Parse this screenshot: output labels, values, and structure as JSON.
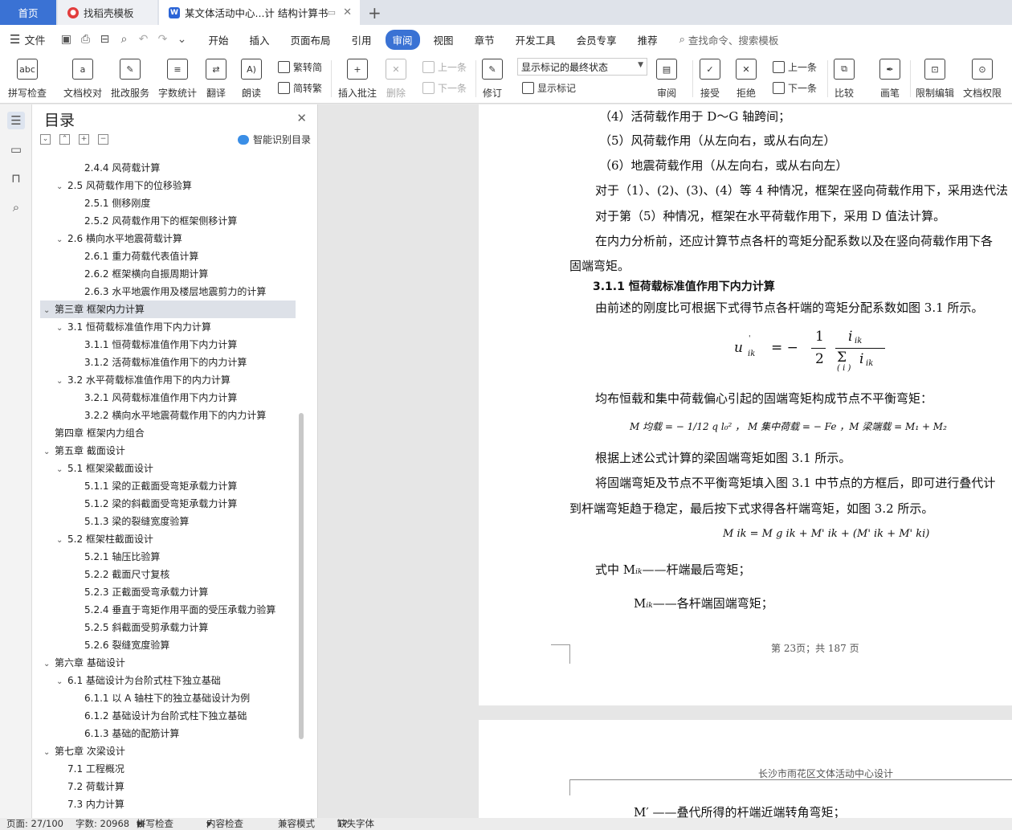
{
  "tabs": [
    {
      "label": "首页"
    },
    {
      "label": "找稻壳模板"
    },
    {
      "label": "某文体活动中心...计 结构计算书"
    }
  ],
  "menubar": {
    "file_label": "文件",
    "items": [
      "开始",
      "插入",
      "页面布局",
      "引用",
      "审阅",
      "视图",
      "章节",
      "开发工具",
      "会员专享",
      "推荐"
    ],
    "active": "审阅",
    "search_label": "查找命令、搜索模板"
  },
  "ribbon": {
    "spellcheck": "拼写检查",
    "doc_proof": "文档校对",
    "review_service": "批改服务",
    "word_count": "字数统计",
    "translate": "翻译",
    "read_aloud": "朗读",
    "trad_conv": "繁转简",
    "simp_conv": "简转繁",
    "insert_comment": "插入批注",
    "delete": "删除",
    "prev_comment": "上一条",
    "next_comment": "下一条",
    "track": "修订",
    "markup_select": "显示标记的最终状态",
    "show_markup": "显示标记",
    "review": "审阅",
    "accept": "接受",
    "reject": "拒绝",
    "prev_change": "上一条",
    "next_change": "下一条",
    "compare": "比较",
    "pen": "画笔",
    "restrict": "限制编辑",
    "doc_perm": "文档权限"
  },
  "toc": {
    "title": "目录",
    "smart_label": "智能识别目录",
    "items": [
      {
        "text": "2.4.4  风荷载计算",
        "level": 3
      },
      {
        "text": "2.5  风荷载作用下的位移验算",
        "level": 2
      },
      {
        "text": "2.5.1  侧移刚度",
        "level": 3
      },
      {
        "text": "2.5.2  风荷载作用下的框架侧移计算",
        "level": 3
      },
      {
        "text": "2.6  横向水平地震荷载计算",
        "level": 2
      },
      {
        "text": "2.6.1  重力荷载代表值计算",
        "level": 3
      },
      {
        "text": "2.6.2  框架横向自振周期计算",
        "level": 3
      },
      {
        "text": "2.6.3 水平地震作用及楼层地震剪力的计算",
        "level": 3
      },
      {
        "text": "第三章  框架内力计算",
        "level": 1
      },
      {
        "text": "3.1  恒荷载标准值作用下内力计算",
        "level": 2
      },
      {
        "text": "3.1.1  恒荷载标准值作用下内力计算",
        "level": 3
      },
      {
        "text": "3.1.2  活荷载标准值作用下的内力计算",
        "level": 3
      },
      {
        "text": "3.2  水平荷载标准值作用下的内力计算",
        "level": 2
      },
      {
        "text": "3.2.1  风荷载标准值作用下内力计算",
        "level": 3
      },
      {
        "text": "3.2.2  横向水平地震荷载作用下的内力计算",
        "level": 3
      },
      {
        "text": "第四章  框架内力组合",
        "level": 1
      },
      {
        "text": "第五章  截面设计",
        "level": 1
      },
      {
        "text": "5.1  框架梁截面设计",
        "level": 2
      },
      {
        "text": "5.1.1  梁的正截面受弯矩承载力计算",
        "level": 3
      },
      {
        "text": "5.1.2  梁的斜截面受弯矩承载力计算",
        "level": 3
      },
      {
        "text": "5.1.3  梁的裂缝宽度验算",
        "level": 3
      },
      {
        "text": "5.2  框架柱截面设计",
        "level": 2
      },
      {
        "text": "5.2.1  轴压比验算",
        "level": 3
      },
      {
        "text": "5.2.2  截面尺寸复核",
        "level": 3
      },
      {
        "text": "5.2.3  正截面受弯承载力计算",
        "level": 3
      },
      {
        "text": "5.2.4  垂直于弯矩作用平面的受压承载力验算",
        "level": 3
      },
      {
        "text": "5.2.5  斜截面受剪承载力计算",
        "level": 3
      },
      {
        "text": "5.2.6  裂缝宽度验算",
        "level": 3
      },
      {
        "text": "第六章  基础设计",
        "level": 1
      },
      {
        "text": "6.1 基础设计为台阶式柱下独立基础",
        "level": 2
      },
      {
        "text": "6.1.1 以 A 轴柱下的独立基础设计为例",
        "level": 3
      },
      {
        "text": "6.1.2 基础设计为台阶式柱下独立基础",
        "level": 3
      },
      {
        "text": "6.1.3 基础的配筋计算",
        "level": 3
      },
      {
        "text": "第七章  次梁设计",
        "level": 1
      },
      {
        "text": "7.1  工程概况",
        "level": 2
      },
      {
        "text": "7.2  荷载计算",
        "level": 2
      },
      {
        "text": "7.3  内力计算",
        "level": 2
      }
    ]
  },
  "doc": {
    "lines": [
      "（4）活荷载作用于 D～G 轴跨间；",
      "（5）风荷载作用（从左向右，或从右向左）",
      "（6）地震荷载作用（从左向右，或从右向左）",
      "对于（1）、(2)、(3)、(4）等 4 种情况，框架在竖向荷载作用下，采用迭代法",
      "对于第（5）种情况，框架在水平荷载作用下，采用 D 值法计算。",
      "在内力分析前，还应计算节点各杆的弯矩分配系数以及在竖向荷载作用下各",
      "固端弯矩。",
      "3.1.1  恒荷载标准值作用下内力计算",
      "由前述的刚度比可根据下式得节点各杆端的弯矩分配系数如图 3.1 所示。",
      "均布恒载和集中荷载偏心引起的固端弯矩构成节点不平衡弯矩：",
      "根据上述公式计算的梁固端弯矩如图 3.1 所示。",
      "将固端弯矩及节点不平衡弯矩填入图 3.1 中节点的方框后，即可进行叠代计",
      "到杆端弯矩趋于稳定，最后按下式求得各杆端弯矩，如图 3.2 所示。",
      "式中   M",
      "ik",
      "——杆端最后弯矩；",
      "M",
      "ik",
      "——各杆端固端弯矩；"
    ],
    "formula1": {
      "u": "u",
      "u_sub": "ik",
      "u_sup": "'",
      "eq": "=  −",
      "num": "1",
      "den": "2",
      "i_top": "i",
      "i_top_sub": "ik",
      "sigma": "Σ",
      "i_bot": "i",
      "i_bot_sub": "ik",
      "sigma_sub": "( i )"
    },
    "formula2": "M 均载 = − 1/12 q l₀² ，  M 集中荷载 = − Fe ，M 梁端载 = M₁ + M₂",
    "formula3": "M ik = M g ik + M' ik + (M' ik + M' ki)",
    "footer": "第 23页；共 187 页",
    "page2_header": "长沙市雨花区文体活动中心设计",
    "page2_line": "M′  ——叠代所得的杆端近端转角弯矩；"
  },
  "status": {
    "page": "页面: 27/100",
    "words": "字数: 20968",
    "spell": "拼写检查",
    "content": "内容检查",
    "compat": "兼容模式",
    "missing_font": "缺失字体"
  }
}
